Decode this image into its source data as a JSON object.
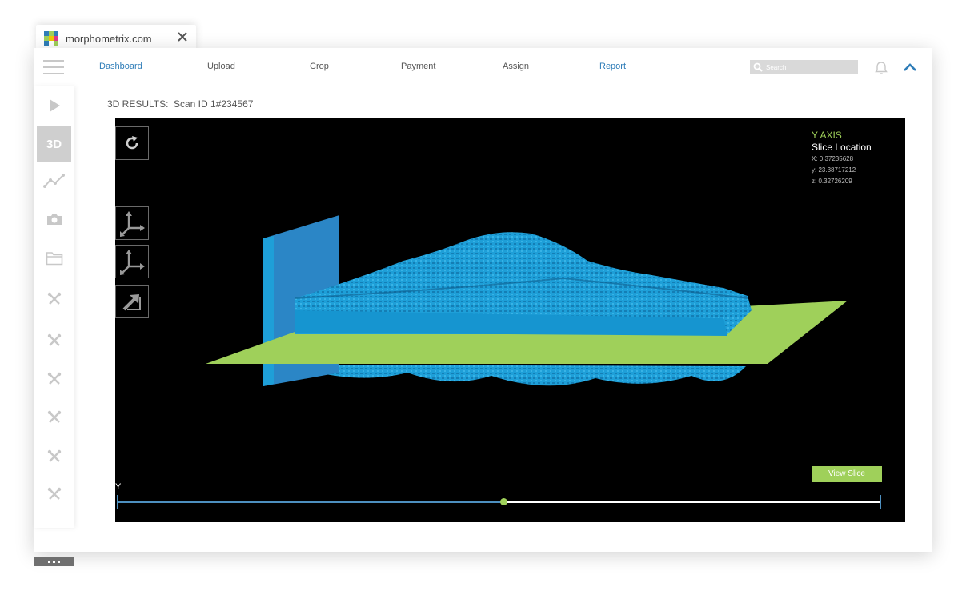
{
  "browser_tab": {
    "title": "morphometrix.com",
    "close_icon": "close-icon"
  },
  "colors": {
    "accent": "#2f7db8",
    "green": "#9fd05a",
    "blue_model": "#1e9fd8",
    "sidebar_active": "#cfcfcf"
  },
  "nav": {
    "items": [
      {
        "label": "Dashboard",
        "active": true
      },
      {
        "label": "Upload",
        "active": false
      },
      {
        "label": "Crop",
        "active": false
      },
      {
        "label": "Payment",
        "active": false
      },
      {
        "label": "Assign",
        "active": false
      },
      {
        "label": "Report",
        "active": true
      }
    ],
    "search_placeholder": "Search"
  },
  "sidebar": {
    "items": [
      {
        "icon": "play-icon"
      },
      {
        "icon": "3d-icon",
        "label": "3D",
        "active": true
      },
      {
        "icon": "line-chart-icon"
      },
      {
        "icon": "camera-icon"
      },
      {
        "icon": "folder-icon"
      },
      {
        "icon": "tools-icon"
      },
      {
        "icon": "tools-icon"
      },
      {
        "icon": "tools-icon"
      },
      {
        "icon": "tools-icon"
      },
      {
        "icon": "tools-icon"
      },
      {
        "icon": "tools-icon"
      }
    ],
    "more_icon": "more-icon"
  },
  "header": {
    "results_label": "3D RESULTS:",
    "scan_id": "Scan ID 1#234567"
  },
  "viewer": {
    "controls": [
      "refresh-icon",
      "axis-icon",
      "axis-icon",
      "expand-arrow-icon"
    ],
    "axis_title": "Y AXIS",
    "slice_title": "Slice Location",
    "x_coord": "X: 0.37235628",
    "y_coord": "y: 23.38717212",
    "z_coord": "z: 0.32726209",
    "view_slice_label": "View Slice",
    "slider_label": "Y",
    "slider_value_fraction": 0.505
  }
}
